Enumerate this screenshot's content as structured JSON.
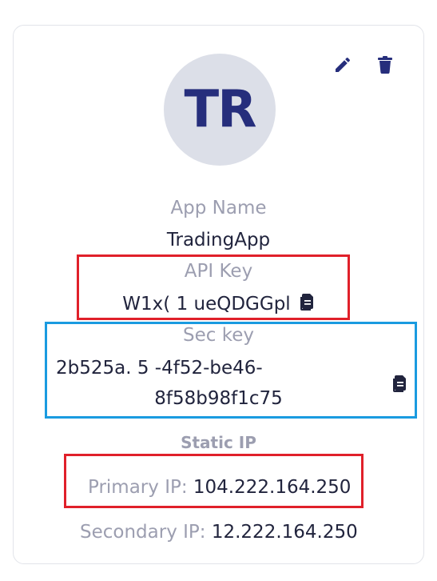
{
  "avatar": {
    "initials": "TR"
  },
  "actions": {
    "edit_icon": "pencil-icon",
    "delete_icon": "trash-icon"
  },
  "app": {
    "label": "App Name",
    "value": "TradingApp"
  },
  "api_key": {
    "label": "API Key",
    "value": "W1x( 1    ueQDGGpl",
    "copy_icon": "copy-icon"
  },
  "sec_key": {
    "label": "Sec key",
    "line1": "2b525a.      5    -4f52-be46-",
    "line2": "8f58b98f1c75",
    "copy_icon": "copy-icon"
  },
  "static_ip": {
    "label": "Static IP",
    "primary_label": "Primary IP:",
    "primary_value": "104.222.164.250",
    "secondary_label": "Secondary IP:",
    "secondary_value": "12.222.164.250"
  },
  "colors": {
    "accent": "#262e7c",
    "avatar_bg": "#dcdfe8",
    "label": "#9c9eb0",
    "value": "#21243d",
    "highlight_red": "#e0202a",
    "highlight_blue": "#1a9be0"
  }
}
